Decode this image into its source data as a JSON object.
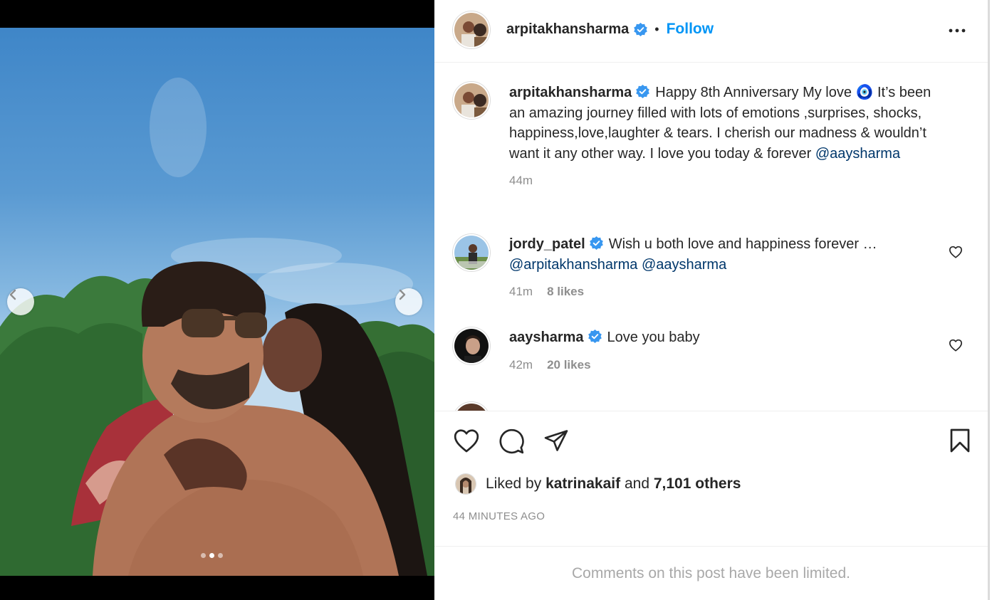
{
  "post": {
    "author": "arpitakhansharma",
    "follow_label": "Follow",
    "separator": "•",
    "carousel": {
      "slides": 3,
      "active_index": 1
    }
  },
  "caption": {
    "username": "arpitakhansharma",
    "text": "Happy 8th Anniversary My love 🧿 It’s been an amazing journey filled with lots of emotions ,surprises, shocks, happiness,love,laughter & tears. I cherish our madness & wouldn’t want it any other way. I love you today & forever ",
    "mention": "@aaysharma",
    "time": "44m"
  },
  "comments": [
    {
      "username": "jordy_patel",
      "text": "Wish u both love and happiness forever …",
      "mentions": "@arpitakhansharma @aaysharma",
      "time": "41m",
      "likes": "8 likes"
    },
    {
      "username": "aaysharma",
      "text": "Love you baby",
      "time": "42m",
      "likes": "20 likes"
    }
  ],
  "engagement": {
    "liked_by_prefix": "Liked by",
    "liked_by_user": "katrinakaif",
    "liked_by_and": "and",
    "others": "7,101 others",
    "timestamp": "44 MINUTES AGO"
  },
  "footer": {
    "limited_text": "Comments on this post have been limited."
  },
  "colors": {
    "accent": "#0095f6",
    "verified": "#3897f0",
    "mention": "#00376b",
    "muted": "#8e8e8e"
  },
  "icons": [
    "chevron-left-icon",
    "chevron-right-icon",
    "verified-badge-icon",
    "more-options-icon",
    "heart-icon",
    "comment-icon",
    "share-icon",
    "bookmark-icon"
  ]
}
